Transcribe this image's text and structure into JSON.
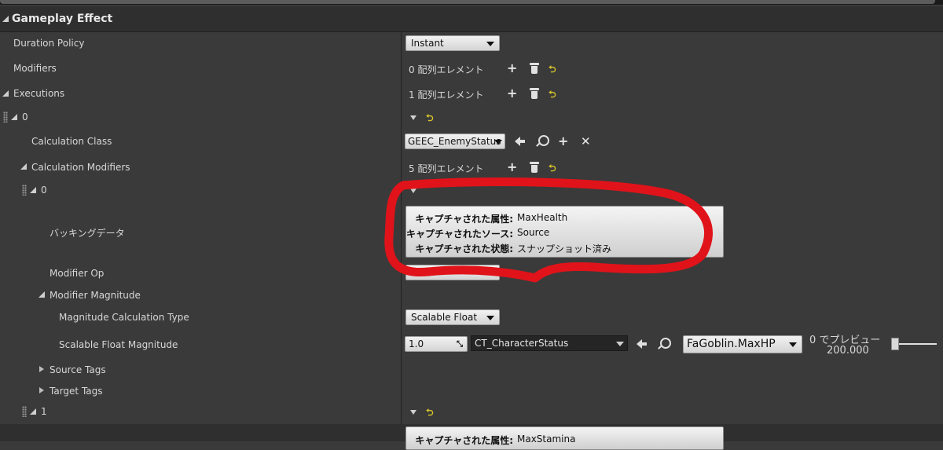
{
  "section_title": "Gameplay Effect",
  "rows": {
    "duration_policy": "Duration Policy",
    "modifiers": "Modifiers",
    "executions": "Executions",
    "exec_index_0": "0",
    "calculation_class": "Calculation Class",
    "calculation_modifiers": "Calculation Modifiers",
    "calc_mod_index_0": "0",
    "backing_data": "バッキングデータ",
    "modifier_op": "Modifier Op",
    "modifier_magnitude": "Modifier Magnitude",
    "magnitude_calc_type": "Magnitude Calculation Type",
    "scalable_float_magnitude": "Scalable Float Magnitude",
    "source_tags": "Source Tags",
    "target_tags": "Target Tags",
    "calc_mod_index_1": "1"
  },
  "values": {
    "duration_policy": "Instant",
    "modifiers_count": "0 配列エレメント",
    "executions_count": "1 配列エレメント",
    "calculation_class": "GEEC_EnemyStatus",
    "calc_modifiers_count": "5 配列エレメント",
    "magnitude_calc_type": "Scalable Float",
    "scalable_value": "1.0",
    "curve_table": "CT_CharacterStatus",
    "curve_row": "FaGoblin.MaxHP",
    "preview_label": "0 でプレビュー",
    "preview_value": "200.000",
    "reset_glyph": "⮌"
  },
  "capture_box": {
    "attr_key": "キャプチャされた属性:",
    "attr_value": "MaxHealth",
    "source_key": "キャプチャされたソース:",
    "source_value": "Source",
    "snapshot_key": "キャプチャされた状態:",
    "snapshot_value": "スナップショット済み"
  },
  "capture_box_2": {
    "attr_key": "キャプチャされた属性:",
    "attr_value": "MaxStamina"
  },
  "colors": {
    "annotation": "#e0131a",
    "reset": "#d8c52a"
  }
}
